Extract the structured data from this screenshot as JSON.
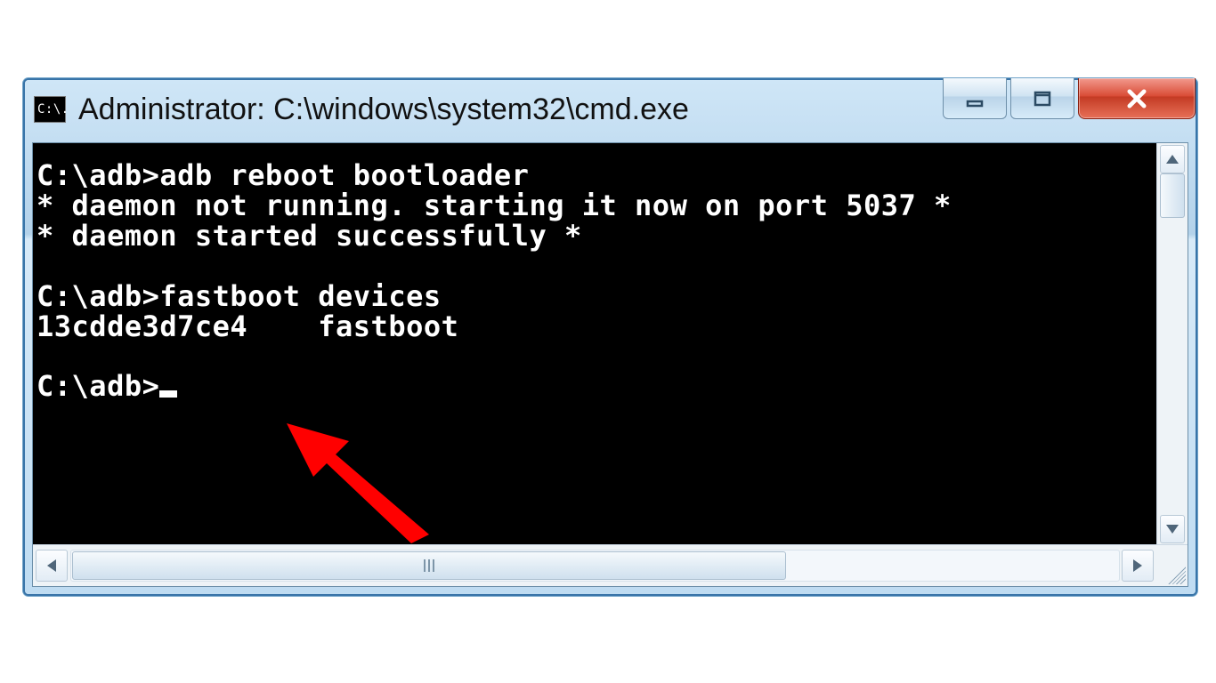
{
  "window": {
    "title": "Administrator: C:\\windows\\system32\\cmd.exe",
    "icon_label": "C:\\."
  },
  "terminal": {
    "lines": [
      "C:\\adb>adb reboot bootloader",
      "* daemon not running. starting it now on port 5037 *",
      "* daemon started successfully *",
      "",
      "C:\\adb>fastboot devices",
      "13cdde3d7ce4    fastboot",
      "",
      "C:\\adb>"
    ],
    "prompt_path": "C:\\adb>",
    "commands": [
      "adb reboot bootloader",
      "fastboot devices"
    ],
    "device_id": "13cdde3d7ce4",
    "device_mode": "fastboot",
    "daemon_port": 5037
  },
  "colors": {
    "terminal_bg": "#000000",
    "terminal_fg": "#ffffff",
    "close_red": "#c33a23",
    "annotation_red": "#ff0000"
  }
}
